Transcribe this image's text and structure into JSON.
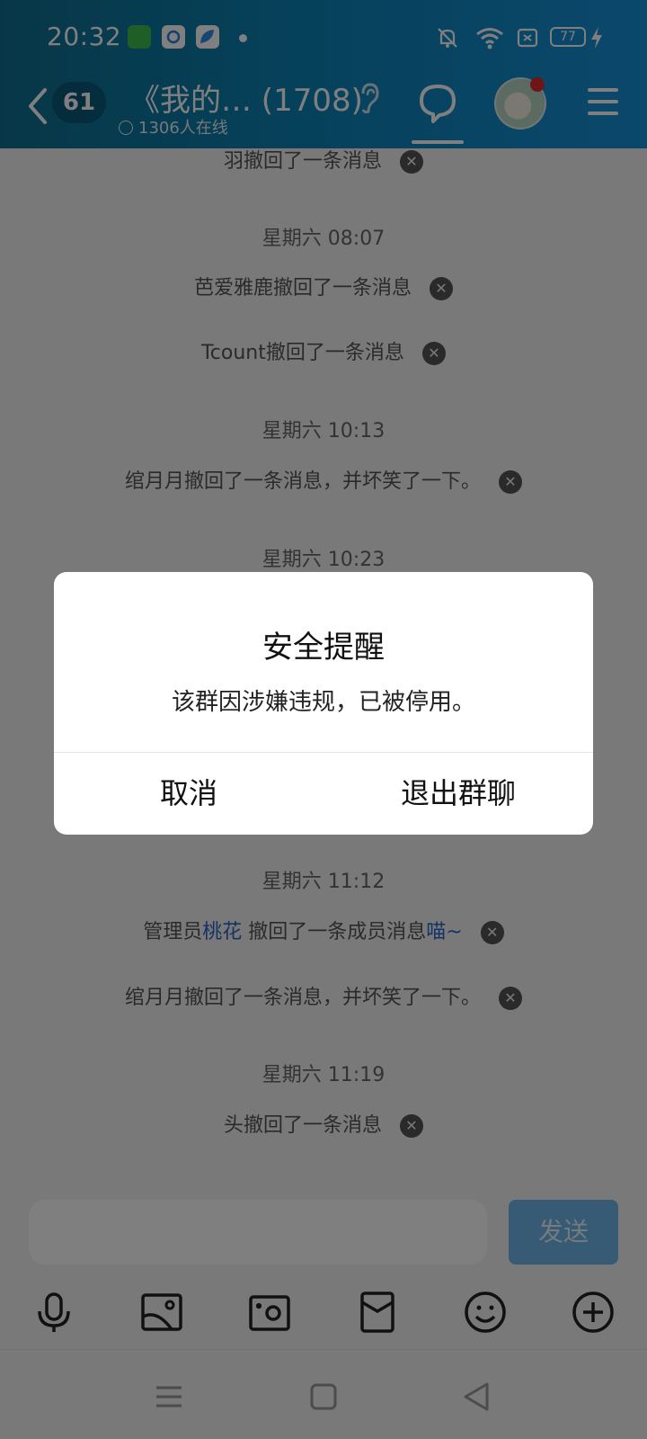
{
  "status_bar": {
    "time": "20:32",
    "battery": "77"
  },
  "header": {
    "unread_count": "61",
    "title": "《我的… (1708)",
    "online": "1306人在线"
  },
  "messages": [
    {
      "type": "notice",
      "text": "羽撤回了一条消息"
    },
    {
      "type": "time",
      "text": "星期六 08:07"
    },
    {
      "type": "notice",
      "text": "芭爱雅鹿撤回了一条消息"
    },
    {
      "type": "notice",
      "text": "Tcount撤回了一条消息"
    },
    {
      "type": "time",
      "text": "星期六 10:13"
    },
    {
      "type": "notice",
      "text": "绾月月撤回了一条消息，并坏笑了一下。"
    },
    {
      "type": "time",
      "text": "星期六 10:23"
    },
    {
      "type": "time",
      "text": "星期六 11:12"
    },
    {
      "type": "notice_rich",
      "prefix": "管理员",
      "admin": "桃花",
      "middle": " 撤回了一条成员消息",
      "suffix": "喵~"
    },
    {
      "type": "notice",
      "text": "绾月月撤回了一条消息，并坏笑了一下。"
    },
    {
      "type": "time",
      "text": "星期六 11:19"
    },
    {
      "type": "notice",
      "text": "头撤回了一条消息"
    }
  ],
  "input": {
    "placeholder": "",
    "send_label": "发送"
  },
  "toolbar": [
    "microphone-icon",
    "image-icon",
    "camera-icon",
    "red-packet-icon",
    "emoji-icon",
    "plus-icon"
  ],
  "dialog": {
    "title": "安全提醒",
    "message": "该群因涉嫌违规，已被停用。",
    "cancel_label": "取消",
    "exit_label": "退出群聊"
  },
  "colors": {
    "header_gradient_start": "#0f6f8f",
    "header_gradient_end": "#1590d8",
    "send_button": "#6fb4ea",
    "link": "#2b64c8"
  }
}
